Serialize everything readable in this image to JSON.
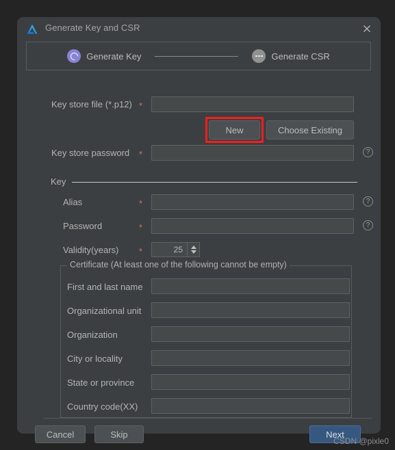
{
  "window": {
    "title": "Generate Key and CSR",
    "logo_icon": "android-studio-logo-icon",
    "close_icon": "close-icon"
  },
  "wizard": {
    "steps": [
      {
        "label": "Generate Key",
        "state": "active",
        "icon": "spinner-ring-icon"
      },
      {
        "label": "Generate CSR",
        "state": "inactive",
        "icon": "three-dots-icon"
      }
    ]
  },
  "form": {
    "keystore_file": {
      "label": "Key store file (*.p12)",
      "required_marker": "*",
      "value": "",
      "placeholder": ""
    },
    "new_button": "New",
    "choose_existing_button": "Choose Existing",
    "keystore_password": {
      "label": "Key store password",
      "required_marker": "*",
      "value": "",
      "placeholder": "",
      "help_icon": "help-icon"
    },
    "key_section_label": "Key",
    "alias": {
      "label": "Alias",
      "required_marker": "*",
      "value": "",
      "placeholder": "",
      "help_icon": "help-icon"
    },
    "password": {
      "label": "Password",
      "required_marker": "*",
      "value": "",
      "placeholder": "",
      "help_icon": "help-icon"
    },
    "validity": {
      "label": "Validity(years)",
      "required_marker": "*",
      "value": "25"
    },
    "certificate": {
      "legend": "Certificate (At least one of the following cannot be empty)",
      "fields": [
        {
          "label": "First and last name",
          "value": ""
        },
        {
          "label": "Organizational unit",
          "value": ""
        },
        {
          "label": "Organization",
          "value": ""
        },
        {
          "label": "City or locality",
          "value": ""
        },
        {
          "label": "State or province",
          "value": ""
        },
        {
          "label": "Country code(XX)",
          "value": ""
        }
      ]
    }
  },
  "footer": {
    "cancel": "Cancel",
    "skip": "Skip",
    "next": "Next"
  },
  "annotation": {
    "highlight_target": "New",
    "color": "#fc1c1c"
  },
  "watermark": "CSDN @pixle0",
  "colors": {
    "page_background": "#242424",
    "dialog_background": "#3c3f41",
    "input_background": "#45494a",
    "accent_primary": "#365880",
    "step_active": "#8884d5",
    "step_inactive": "#919191",
    "required_marker": "#d0706a"
  }
}
